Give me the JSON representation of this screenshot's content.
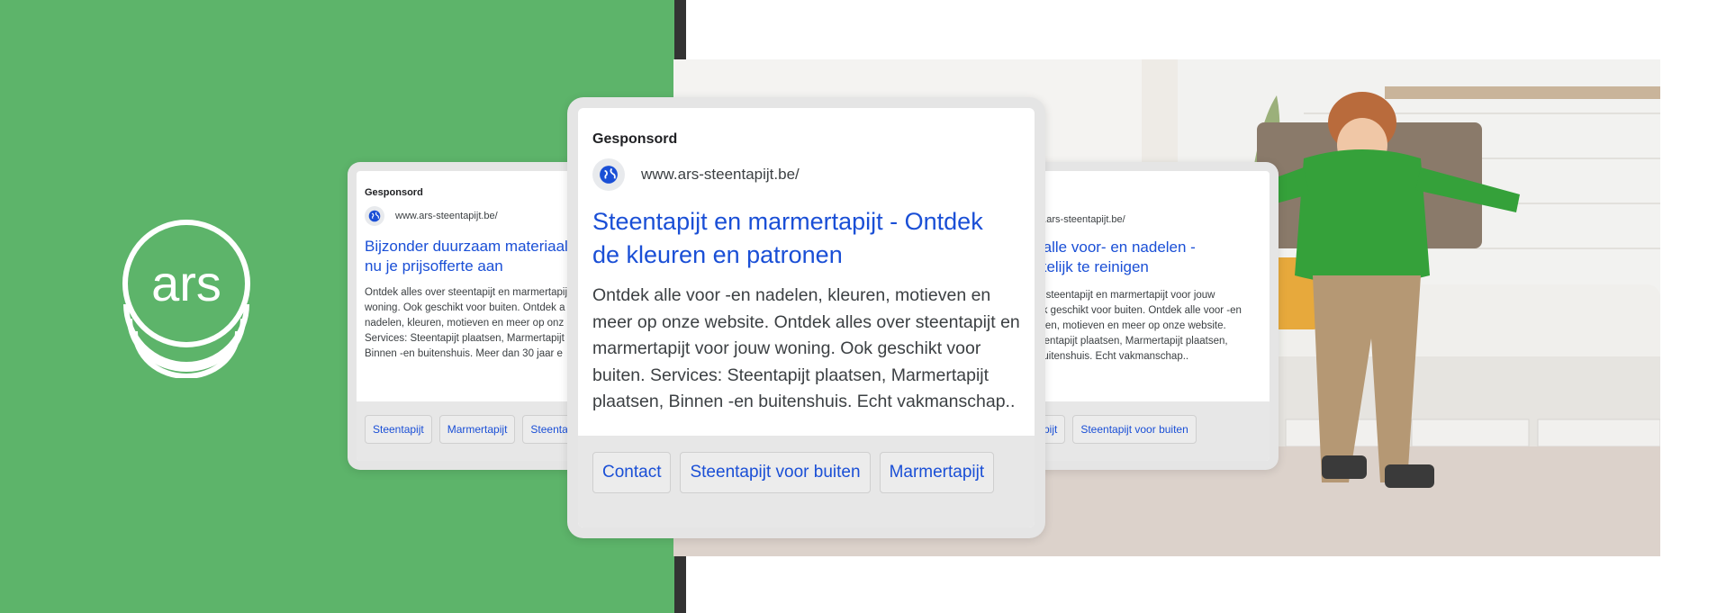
{
  "colors": {
    "brand": "#5db46a",
    "link": "#1a4fd6"
  },
  "logo": {
    "text": "ars",
    "icon": "coin-stack-icon"
  },
  "ads": {
    "left": {
      "sponsored": "Gesponsord",
      "url": "www.ars-steentapijt.be/",
      "headline_line1": "Bijzonder duurzaam materiaal",
      "headline_line2": "nu je prijsofferte aan",
      "desc_lines": [
        "Ontdek alles over steentapijt en marmertapijt",
        "woning. Ook geschikt voor buiten. Ontdek a",
        "nadelen, kleuren, motieven en meer op onz",
        "Services: Steentapijt plaatsen, Marmertapijt",
        "Binnen -en buitenshuis. Meer dan 30 jaar e"
      ],
      "chips": [
        "Steentapijt",
        "Marmertapijt",
        "Steentapijt"
      ]
    },
    "center": {
      "sponsored": "Gesponsord",
      "url": "www.ars-steentapijt.be/",
      "headline_line1": "Steentapijt en marmertapijt - Ontdek",
      "headline_line2": "de kleuren en patronen",
      "desc_lines": [
        "Ontdek alle voor -en nadelen, kleuren, motieven en",
        "meer op onze website. Ontdek alles over steentapijt en",
        "marmertapijt voor jouw woning. Ook geschikt voor",
        "buiten. Services: Steentapijt plaatsen, Marmertapijt",
        "plaatsen, Binnen -en buitenshuis. Echt vakmanschap.."
      ],
      "chips": [
        "Contact",
        "Steentapijt voor buiten",
        "Marmertapijt"
      ]
    },
    "right": {
      "sponsored": "ord",
      "url": "www.ars-steentapijt.be/",
      "headline_line1": "ek alle voor- en nadelen -",
      "headline_line2": "akkelijk te reinigen",
      "desc_lines": [
        "over steentapijt en marmertapijt voor jouw",
        ". Ook geschikt voor buiten. Ontdek alle voor -en",
        "kleuren, motieven en meer op onze website.",
        ": Steentapijt plaatsen, Marmertapijt plaatsen,",
        "en buitenshuis. Echt vakmanschap.."
      ],
      "chips": [
        "rtapijt",
        "Steentapijt voor buiten"
      ]
    }
  }
}
